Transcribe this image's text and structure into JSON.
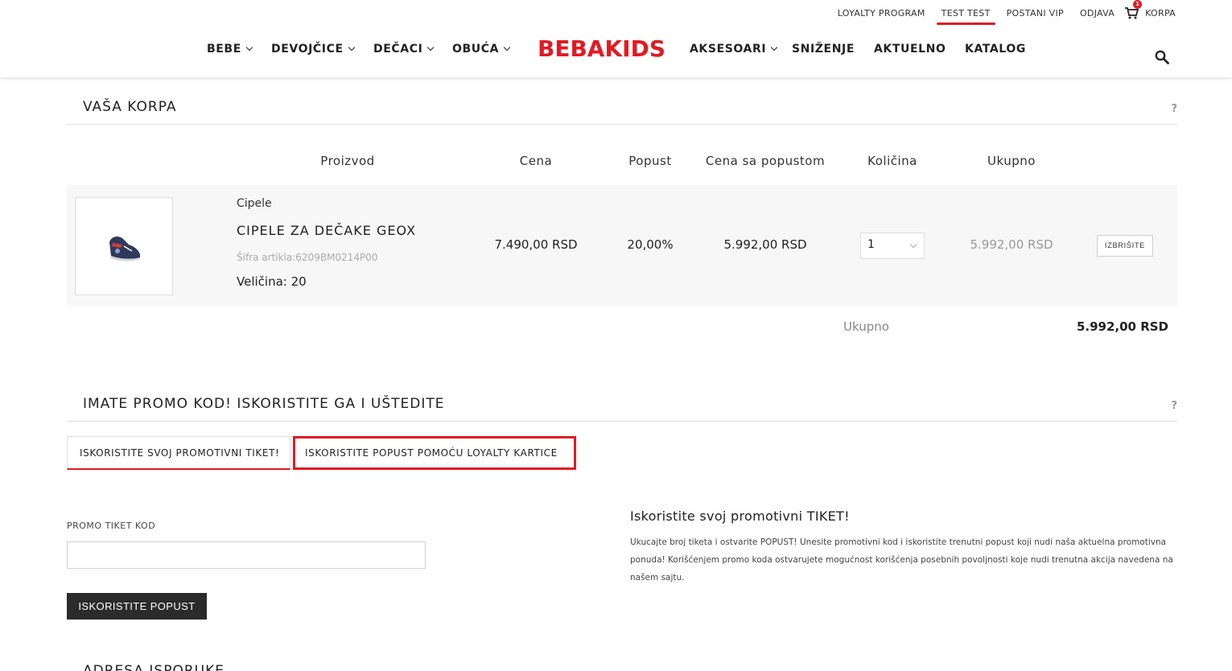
{
  "header": {
    "top_links": [
      "LOYALTY PROGRAM",
      "TEST TEST",
      "POSTANI VIP",
      "ODJAVA"
    ],
    "cart_label": "KORPA",
    "cart_count": "1",
    "logo": "BEBAKIDS",
    "nav_left": [
      "BEBE",
      "DEVOJČICE",
      "DEČACI",
      "OBUĆA"
    ],
    "nav_right": [
      "AKSESOARI",
      "SNIŽENJE",
      "AKTUELNO",
      "KATALOG"
    ],
    "accent_color": "#e01b24"
  },
  "cart": {
    "title": "VAŠA KORPA",
    "help": "?",
    "columns": [
      "Proizvod",
      "Cena",
      "Popust",
      "Cena sa popustom",
      "Količina",
      "Ukupno"
    ],
    "item": {
      "category": "Cipele",
      "name": "CIPELE ZA DEČAKE GEOX",
      "sku": "Šifra artikla:6209BM0214P00",
      "size": "Veličina: 20",
      "price": "7.490,00 RSD",
      "discount": "20,00%",
      "discounted_price": "5.992,00 RSD",
      "quantity": "1",
      "total": "5.992,00 RSD",
      "delete_label": "IZBRIŠITE"
    },
    "total_label": "Ukupno",
    "total_value": "5.992,00 RSD"
  },
  "promo": {
    "title": "IMATE PROMO KOD! ISKORISTITE GA I UŠTEDITE",
    "help": "?",
    "tabs": [
      "ISKORISTITE SVOJ PROMOTIVNI TIKET!",
      "ISKORISTITE POPUST POMOĆU LOYALTY KARTICE"
    ],
    "field_label": "PROMO TIKET KOD",
    "field_value": "",
    "button_label": "ISKORISTITE POPUST",
    "info_title": "Iskoristite svoj promotivni TIKET!",
    "info_text": "Ukucajte broj tiketa i ostvarite POPUST! Unesite promotivni kod i iskoristite trenutni popust koji nudi naša aktuelna promotivna ponuda! Korišćenjem promo koda ostvarujete mogućnost korišćenja posebnih povoljnosti koje nudi trenutna akcija navedena na našem sajtu."
  },
  "next_section": {
    "title": "ADRESA ISPORUKE"
  }
}
